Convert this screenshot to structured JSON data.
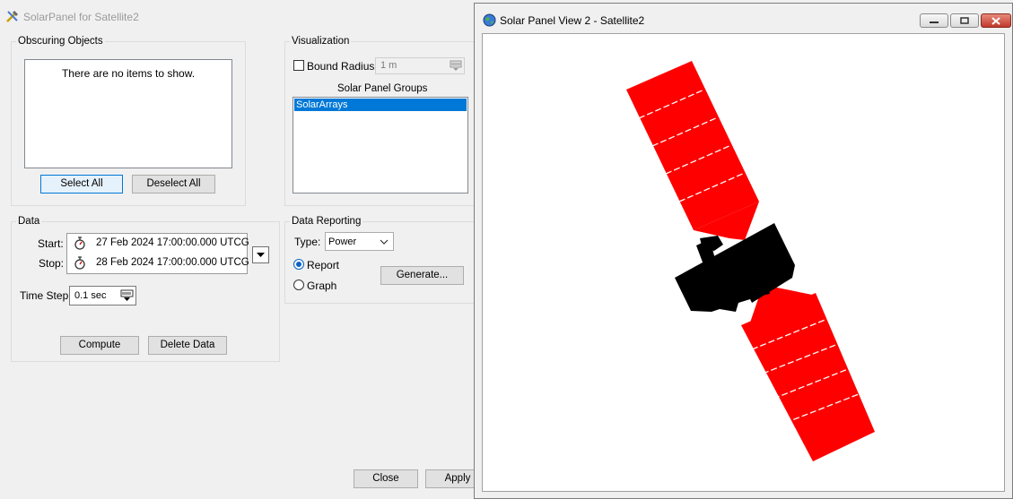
{
  "dialog": {
    "title": "SolarPanel for Satellite2",
    "obscuring": {
      "label": "Obscuring Objects",
      "empty_text": "There are no items to show.",
      "select_all": "Select All",
      "deselect_all": "Deselect All"
    },
    "visualization": {
      "label": "Visualization",
      "bound_radius_label": "Bound Radius:",
      "bound_radius_value": "1 m",
      "groups_label": "Solar Panel Groups",
      "groups": [
        "SolarArrays"
      ]
    },
    "data": {
      "label": "Data",
      "start_label": "Start:",
      "start_value": "27 Feb 2024 17:00:00.000 UTCG",
      "stop_label": "Stop:",
      "stop_value": "28 Feb 2024 17:00:00.000 UTCG",
      "timestep_label": "Time Step:",
      "timestep_value": "0.1 sec",
      "compute": "Compute",
      "delete": "Delete Data"
    },
    "reporting": {
      "label": "Data Reporting",
      "type_label": "Type:",
      "type_value": "Power",
      "report": "Report",
      "graph": "Graph",
      "generate": "Generate..."
    },
    "close": "Close",
    "apply": "Apply"
  },
  "view": {
    "title": "Solar Panel View 2 - Satellite2"
  },
  "colors": {
    "panel": "#ff0000",
    "body": "#000000",
    "selection": "#0078d7"
  }
}
